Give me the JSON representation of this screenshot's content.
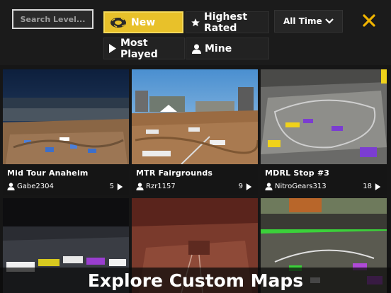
{
  "search": {
    "placeholder": "Search Level..."
  },
  "tabs": {
    "new": "New",
    "highest_rated": "Highest Rated",
    "most_played": "Most Played",
    "mine": "Mine"
  },
  "filter": {
    "selected": "All Time"
  },
  "maps": [
    {
      "title": "Mid Tour Anaheim",
      "author": "Gabe2304",
      "count": "5"
    },
    {
      "title": "MTR Fairgrounds",
      "author": "Rzr1157",
      "count": "9"
    },
    {
      "title": "MDRL Stop #3",
      "author": "NitroGears313",
      "count": "18"
    }
  ],
  "banner": {
    "text": "Explore Custom Maps"
  },
  "colors": {
    "accent": "#e8c12a",
    "close": "#f0b400"
  }
}
